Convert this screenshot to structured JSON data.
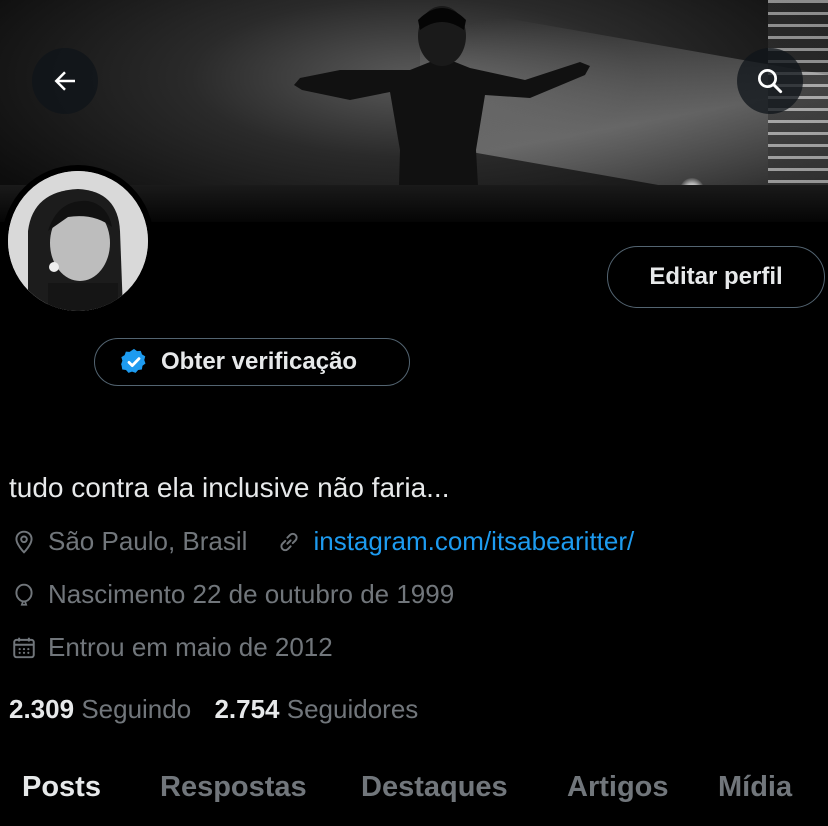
{
  "header": {
    "back_icon": "arrow-left-icon",
    "search_icon": "search-icon"
  },
  "profile": {
    "edit_label": "Editar perfil",
    "verify_label": "Obter verificação",
    "bio": "tudo contra ela inclusive não faria...",
    "location": "São Paulo, Brasil",
    "website": "instagram.com/itsabearitter/",
    "birth": "Nascimento 22 de outubro de 1999",
    "joined": "Entrou em maio de 2012",
    "following_count": "2.309",
    "following_label": "Seguindo",
    "followers_count": "2.754",
    "followers_label": "Seguidores"
  },
  "tabs": [
    {
      "label": "Posts"
    },
    {
      "label": "Respostas"
    },
    {
      "label": "Destaques"
    },
    {
      "label": "Artigos"
    },
    {
      "label": "Mídia"
    }
  ],
  "colors": {
    "background": "#000000",
    "text_primary": "#e7e9ea",
    "text_secondary": "#71767b",
    "link": "#1d9bf0",
    "verified_badge": "#1d9bf0",
    "border": "#536471"
  }
}
